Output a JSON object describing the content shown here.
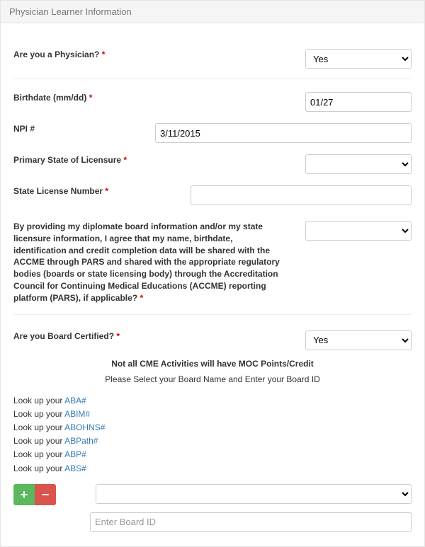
{
  "header": {
    "title": "Physician Learner Information"
  },
  "fields": {
    "physician": {
      "label": "Are you a Physician?",
      "required": true,
      "value": "Yes"
    },
    "birthdate": {
      "label": "Birthdate (mm/dd)",
      "required": true,
      "value": "01/27"
    },
    "npi": {
      "label": "NPI #",
      "required": false,
      "value": "3/11/2015"
    },
    "primary_state": {
      "label": "Primary State of Licensure",
      "required": true,
      "value": ""
    },
    "state_license": {
      "label": "State License Number",
      "required": true,
      "value": ""
    },
    "consent": {
      "label": "By providing my diplomate board information and/or my state licensure information, I agree that my name, birthdate, identification and credit completion data will be shared with the ACCME through PARS and shared with the appropriate regulatory bodies (boards or state licensing body) through the Accreditation Council for Continuing Medical Educations (ACCME) reporting platform (PARS), if applicable?",
      "required": true,
      "value": ""
    },
    "board_certified": {
      "label": "Are you Board Certified?",
      "required": true,
      "value": "Yes"
    }
  },
  "notices": {
    "moc_note": "Not all CME Activities will have MOC Points/Credit",
    "board_instruction": "Please Select your Board Name and Enter your Board ID"
  },
  "lookups": {
    "prefix": "Look up your ",
    "items": [
      {
        "text": "ABA#"
      },
      {
        "text": "ABIM#"
      },
      {
        "text": "ABOHNS#"
      },
      {
        "text": "ABPath#"
      },
      {
        "text": "ABP#"
      },
      {
        "text": "ABS#"
      }
    ]
  },
  "board_entry": {
    "select_value": "",
    "input_placeholder": "Enter Board ID",
    "input_value": ""
  },
  "glyphs": {
    "plus": "+",
    "minus": "−"
  }
}
